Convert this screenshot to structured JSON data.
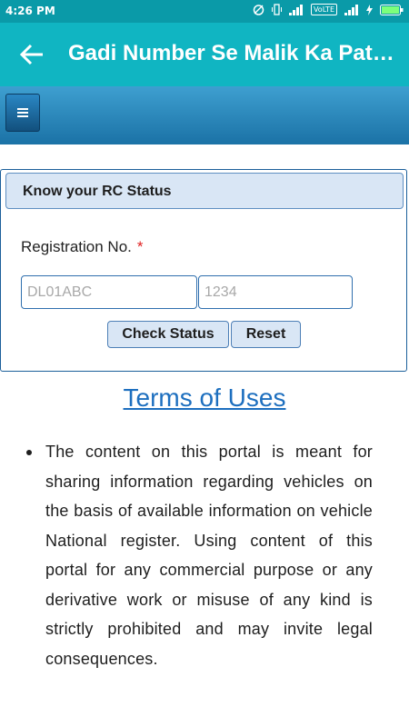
{
  "status_bar": {
    "time": "4:26 PM",
    "volte": "VoLTE"
  },
  "app_bar": {
    "title": "Gadi Number Se Malik Ka Pata Karen"
  },
  "rc_form": {
    "header": "Know your RC Status",
    "registration_label": "Registration No.",
    "required_mark": "*",
    "input1_placeholder": "DL01ABC",
    "input2_placeholder": "1234",
    "check_button": "Check Status",
    "reset_button": "Reset"
  },
  "terms": {
    "title": "Terms of Uses",
    "items": [
      "The content on this portal is meant for sharing information regarding vehicles on the basis of available information on vehicle National register. Using content of this portal for any commercial purpose or any derivative work or misuse of any kind is strictly prohibited and may invite legal consequences."
    ]
  },
  "colors": {
    "status_bar": "#0a9aa8",
    "app_bar": "#10b5c2",
    "nav_strip": "#1b72a6",
    "terms_title": "#1d6fbf"
  },
  "icons": {
    "back": "back-arrow-icon",
    "menu": "menu-icon"
  }
}
